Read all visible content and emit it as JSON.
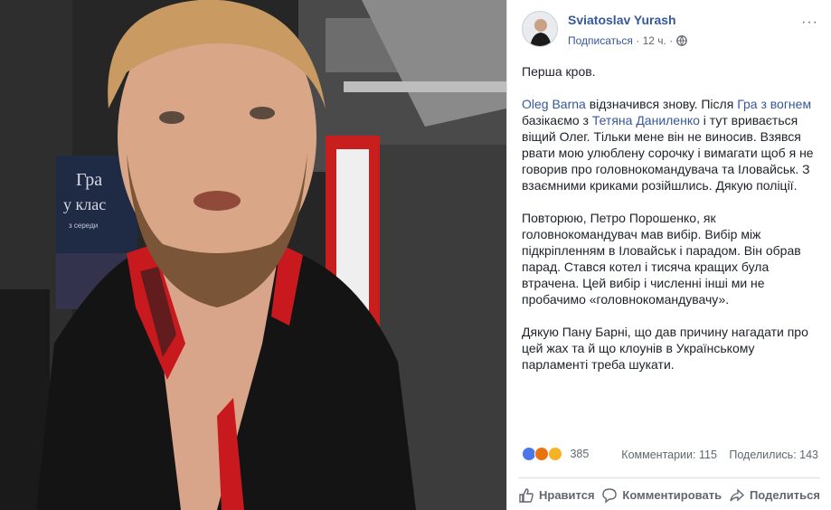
{
  "post": {
    "author": "Sviatoslav Yurash",
    "follow_label": "Подписаться",
    "time": "12 ч.",
    "more_label": "···",
    "paragraphs": {
      "p1": "Перша кров.",
      "p2_link1": "Oleg Barna",
      "p2_text1": " відзначився знову. Після ",
      "p2_link2": "Гра з вогнем",
      "p2_text2": " базікаємо з ",
      "p2_link3": "Тетяна Даниленко",
      "p2_text3": " і тут вривається віщий Олег. Тільки мене він не виносив. Взявся рвати мою улюблену сорочку і вимагати щоб я не говорив про головнокомандувача та Іловайськ. З взаємними криками розійшлись. Дякую поліції.",
      "p3": "Повторюю, Петро Порошенко, як головнокомандувач мав вибір. Вибір між підкріпленням в Іловайськ і парадом. Він обрав парад. Стався котел і тисяча кращих була втрачена. Цей вибір і численні інші ми не пробачимо «головнокомандувачу».",
      "p4": "Дякую Пану Барні, що дав причину нагадати про цей жах та й що клоунів в Українському парламенті треба шукати."
    },
    "reactions": {
      "count": "385",
      "comments": "Комментарии: 115",
      "shares": "Поделились: 143"
    },
    "actions": {
      "like": "Нравится",
      "comment": "Комментировать",
      "share": "Поделиться"
    }
  },
  "photo": {
    "poster_title_1": "Гра",
    "poster_title_2": "у клас",
    "poster_sub": "з середи"
  },
  "colors": {
    "link": "#365899",
    "text": "#1d2129",
    "muted": "#606770"
  }
}
